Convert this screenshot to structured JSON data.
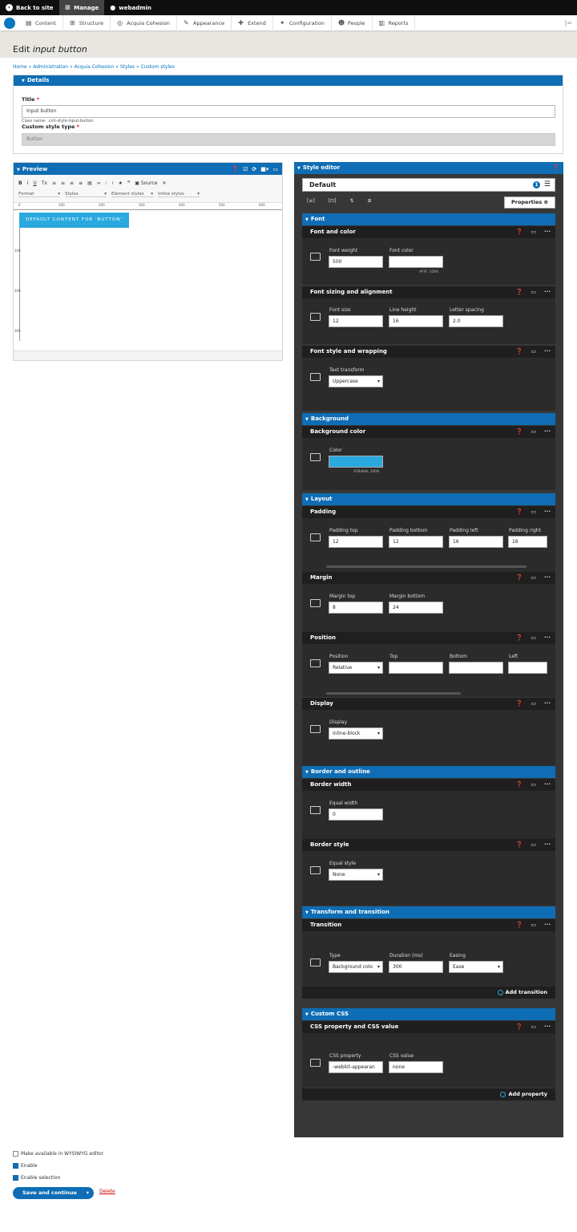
{
  "toolbar": {
    "back_to_site": "Back to site",
    "manage": "Manage",
    "user": "webadmin"
  },
  "tray": {
    "items": [
      "Content",
      "Structure",
      "Acquia Cohesion",
      "Appearance",
      "Extend",
      "Configuration",
      "People",
      "Reports"
    ]
  },
  "page": {
    "title_prefix": "Edit ",
    "title_em": "input button",
    "breadcrumb": "Home » Administration » Acquia Cohesion » Styles » Custom styles"
  },
  "details": {
    "header": "Details",
    "title_label": "Title",
    "title_value": "Input button",
    "class_name": "Class name: .coh-style-input-button",
    "type_label": "Custom style type",
    "type_value": "Button"
  },
  "preview": {
    "header": "Preview",
    "toolbar_row1": [
      "B",
      "I",
      "U",
      "Tx"
    ],
    "source_label": "Source",
    "format": "Format",
    "styles": "Styles",
    "element_styles": "Element styles",
    "inline_styles": "Inline styles",
    "ruler_h": [
      "0",
      "100",
      "200",
      "300",
      "400",
      "500",
      "600"
    ],
    "ruler_v": [
      "100",
      "200",
      "300"
    ],
    "button_text": "DEFAULT CONTENT FOR 'BUTTON'"
  },
  "style_editor": {
    "header": "Style editor",
    "default_label": "Default",
    "badge": "1",
    "properties_button": "Properties",
    "font": {
      "header": "Font",
      "font_and_color": "Font and color",
      "font_weight_label": "Font weight",
      "font_weight": "500",
      "font_color_label": "Font color",
      "font_color_hint": "#FFF, 100%",
      "sizing": "Font sizing and alignment",
      "font_size_label": "Font size",
      "font_size": "12",
      "line_height_label": "Line height",
      "line_height": "16",
      "letter_spacing_label": "Letter spacing",
      "letter_spacing": "2.0",
      "style_wrap": "Font style and wrapping",
      "text_transform_label": "Text transform",
      "text_transform": "Uppercase"
    },
    "background": {
      "header": "Background",
      "bg_color": "Background color",
      "color_label": "Color",
      "color_hint": "#29a9de, 100%",
      "color_hex": "#29a9de"
    },
    "layout": {
      "header": "Layout",
      "padding": "Padding",
      "padding_top_label": "Padding top",
      "padding_top": "12",
      "padding_bottom_label": "Padding bottom",
      "padding_bottom": "12",
      "padding_left_label": "Padding left",
      "padding_left": "16",
      "padding_right_label": "Padding right",
      "padding_right": "16",
      "margin": "Margin",
      "margin_top_label": "Margin top",
      "margin_top": "8",
      "margin_bottom_label": "Margin bottom",
      "margin_bottom": "24",
      "position": "Position",
      "position_label": "Position",
      "position_value": "Relative",
      "top_label": "Top",
      "bottom_label": "Bottom",
      "left_label": "Left",
      "display": "Display",
      "display_label": "Display",
      "display_value": "inline-block"
    },
    "border": {
      "header": "Border and outline",
      "width": "Border width",
      "equal_width_label": "Equal width",
      "equal_width": "0",
      "style": "Border style",
      "equal_style_label": "Equal style",
      "equal_style": "None"
    },
    "transform": {
      "header": "Transform and transition",
      "transition": "Transition",
      "type_label": "Type",
      "type_value": "Background colo",
      "duration_label": "Duration (ms)",
      "duration": "300",
      "easing_label": "Easing",
      "easing": "Ease",
      "add": "Add transition"
    },
    "custom_css": {
      "header": "Custom CSS",
      "row": "CSS property and CSS value",
      "property_label": "CSS property",
      "property": "-webkit-appearan",
      "value_label": "CSS value",
      "value": "none",
      "add": "Add property"
    }
  },
  "footer": {
    "wysiwyg": "Make available in WYSIWYG editor",
    "enable": "Enable",
    "enable_selection": "Enable selection",
    "save": "Save and continue",
    "delete": "Delete"
  }
}
